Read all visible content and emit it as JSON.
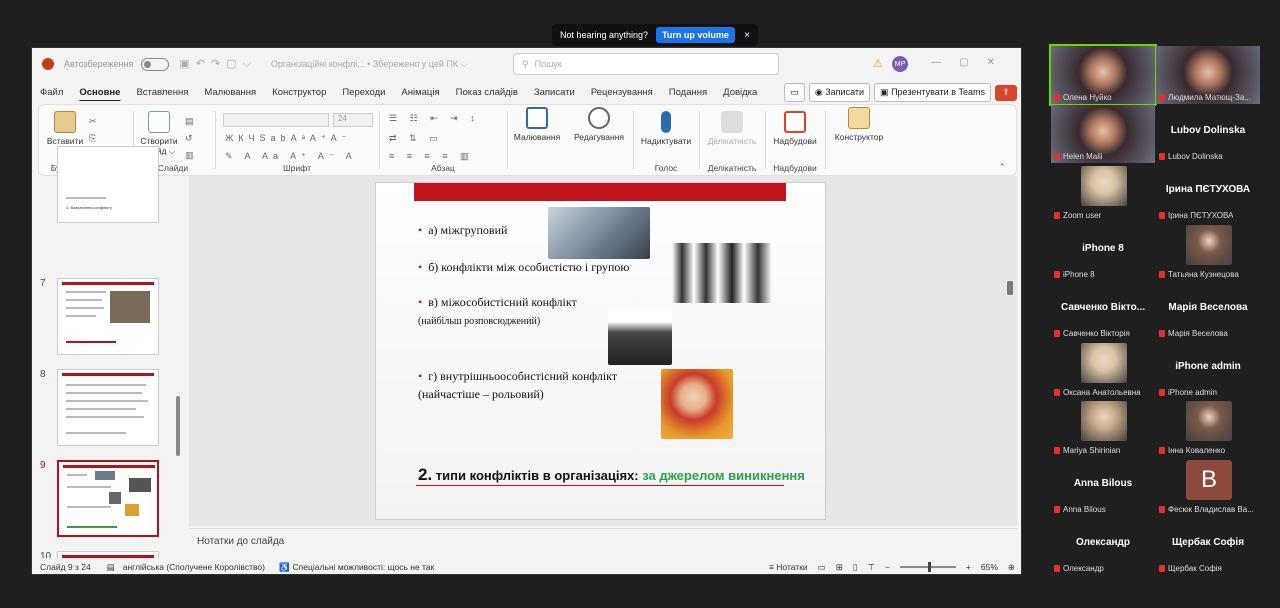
{
  "toast": {
    "text": "Not hearing anything?",
    "button": "Turn up volume",
    "close": "×"
  },
  "ppt": {
    "autosave_label": "Автозбереження",
    "doc_title": "Організаційні конфлі... • Збережено у цей ПК ⌵",
    "search_placeholder": "Пошук",
    "user_initials": "MP",
    "menu": [
      "Файл",
      "Основне",
      "Вставлення",
      "Малювання",
      "Конструктор",
      "Переходи",
      "Анімація",
      "Показ слайдів",
      "Записати",
      "Рецензування",
      "Подання",
      "Довідка"
    ],
    "record_btn": "Записати",
    "teams_btn": "Презентувати в Teams",
    "ribbon": {
      "paste": "Вставити",
      "clipboard_group": "Буфер обміну",
      "new_slide": "Створити слайд ⌵",
      "slides_group": "Слайди",
      "font_size": "24",
      "font_group": "Шрифт",
      "paragraph_group": "Абзац",
      "drawing": "Малювання",
      "editing": "Редагування",
      "dictate": "Надиктувати",
      "voice_group": "Голос",
      "sensitivity": "Делікатність",
      "sensitivity_group": "Делікатність",
      "addins": "Надбудови",
      "addins_group": "Надбудови",
      "designer": "Конструктор"
    },
    "thumbnails": [
      {
        "num": "",
        "label": "1. Визначення конфлікту"
      },
      {
        "num": "7"
      },
      {
        "num": "8"
      },
      {
        "num": "9"
      },
      {
        "num": "10"
      }
    ],
    "slide": {
      "bullets": [
        "а) міжгруповий",
        "б) конфлікти між особистістю і групою",
        "в) міжособистісний конфлікт",
        "г) внутрішньоособистісний конфлікт"
      ],
      "sub1": "(найбільш розповсюджений)",
      "sub2": "(найчастіше – рольовий)",
      "footer_num": "2.",
      "footer_black": " типи конфліктів в організаціях: ",
      "footer_green": "за джерелом виникнення"
    },
    "notes_placeholder": "Нотатки до слайда",
    "status": {
      "slide": "Слайд 9 з 24",
      "language": "англійська (Сполучене Королівство)",
      "accessibility": "Спеціальні можливості: щось не так",
      "notes": "Нотатки",
      "zoom": "65%"
    }
  },
  "participants": [
    {
      "name": "Олена Нуйко",
      "video": true,
      "active": true
    },
    {
      "name": "Людмила Матющ-За...",
      "video": true
    },
    {
      "name": "Helen Malii",
      "video": true
    },
    {
      "name": "Lubov Dolinska",
      "big": "Lubov Dolinska"
    },
    {
      "name": "Zoom user",
      "photo": true
    },
    {
      "name": "Ірина ПЄТУХОВА",
      "big": "Ірина ПЄТУХОВА"
    },
    {
      "name": "iPhone 8",
      "big": "iPhone 8"
    },
    {
      "name": "Татьяна Кузнецова",
      "photo": true
    },
    {
      "name": "Савченко Вікторія",
      "big": "Савченко Вікто..."
    },
    {
      "name": "Марія Веселова",
      "big": "Марія Веселова"
    },
    {
      "name": "Оксана Анатольевна",
      "photo": true
    },
    {
      "name": "iPhone admin",
      "big": "iPhone admin"
    },
    {
      "name": "Mariya Shirinian",
      "photo": true
    },
    {
      "name": "Інна Коваленко",
      "photo": true
    },
    {
      "name": "Anna Bilous",
      "big": "Anna Bilous"
    },
    {
      "name": "Фесюк Владислав Ва...",
      "letter": "B"
    },
    {
      "name": "Олександр",
      "big": "Олександр"
    },
    {
      "name": "Щербак Софія",
      "big": "Щербак Софія"
    }
  ]
}
